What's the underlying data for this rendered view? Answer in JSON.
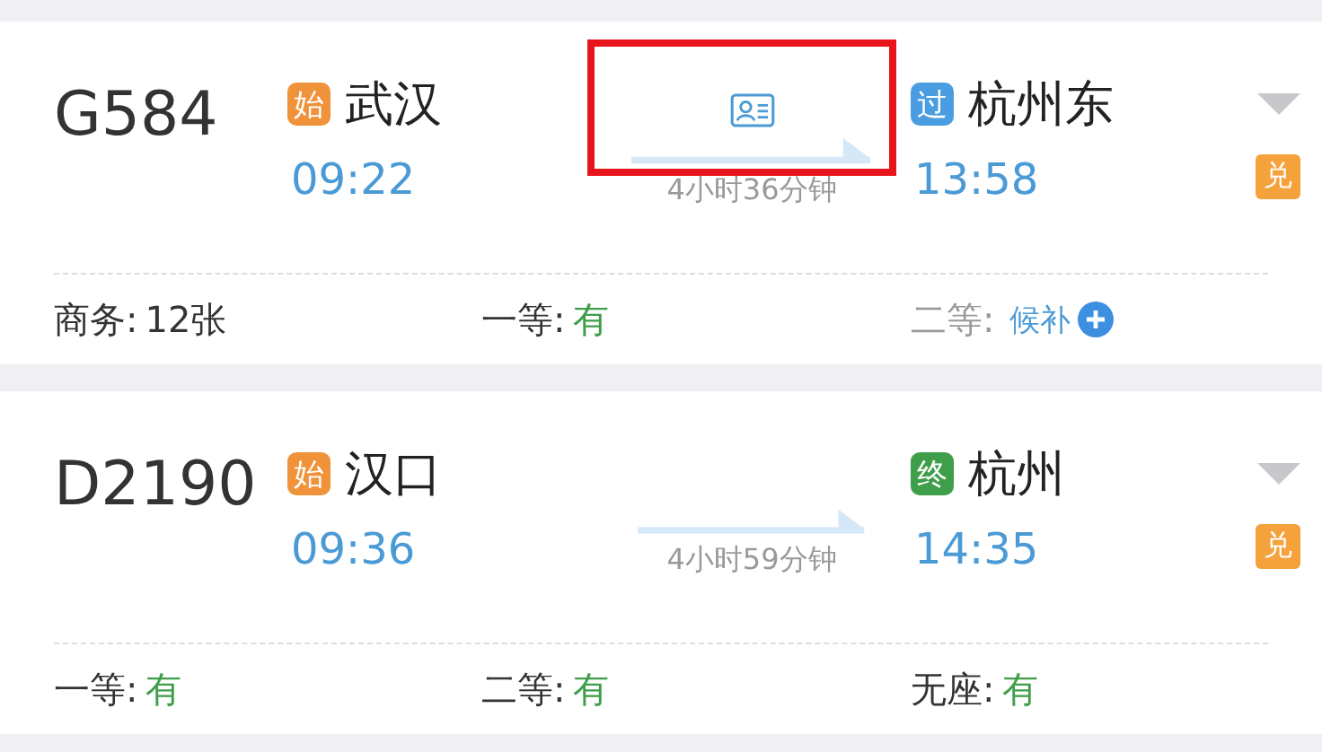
{
  "trains": [
    {
      "number": "G584",
      "from": {
        "badge": "始",
        "color": "#f0923a",
        "name": "武汉",
        "time": "09:22"
      },
      "to": {
        "badge": "过",
        "color": "#4a9de0",
        "name": "杭州东",
        "time": "13:58"
      },
      "duration": "4小时36分钟",
      "id_card": true,
      "highlighted": true,
      "exchange_badge": "兑",
      "seats": [
        {
          "kind": "count",
          "label": "商务:",
          "value": "12张"
        },
        {
          "kind": "available",
          "label": "一等:",
          "value": "有"
        },
        {
          "kind": "waitlist",
          "label": "二等:",
          "value": "候补"
        }
      ]
    },
    {
      "number": "D2190",
      "from": {
        "badge": "始",
        "color": "#f0923a",
        "name": "汉口",
        "time": "09:36"
      },
      "to": {
        "badge": "终",
        "color": "#3f9e4a",
        "name": "杭州",
        "time": "14:35"
      },
      "duration": "4小时59分钟",
      "id_card": false,
      "highlighted": false,
      "exchange_badge": "兑",
      "seats": [
        {
          "kind": "available",
          "label": "一等:",
          "value": "有"
        },
        {
          "kind": "available",
          "label": "二等:",
          "value": "有"
        },
        {
          "kind": "available",
          "label": "无座:",
          "value": "有"
        }
      ]
    }
  ]
}
